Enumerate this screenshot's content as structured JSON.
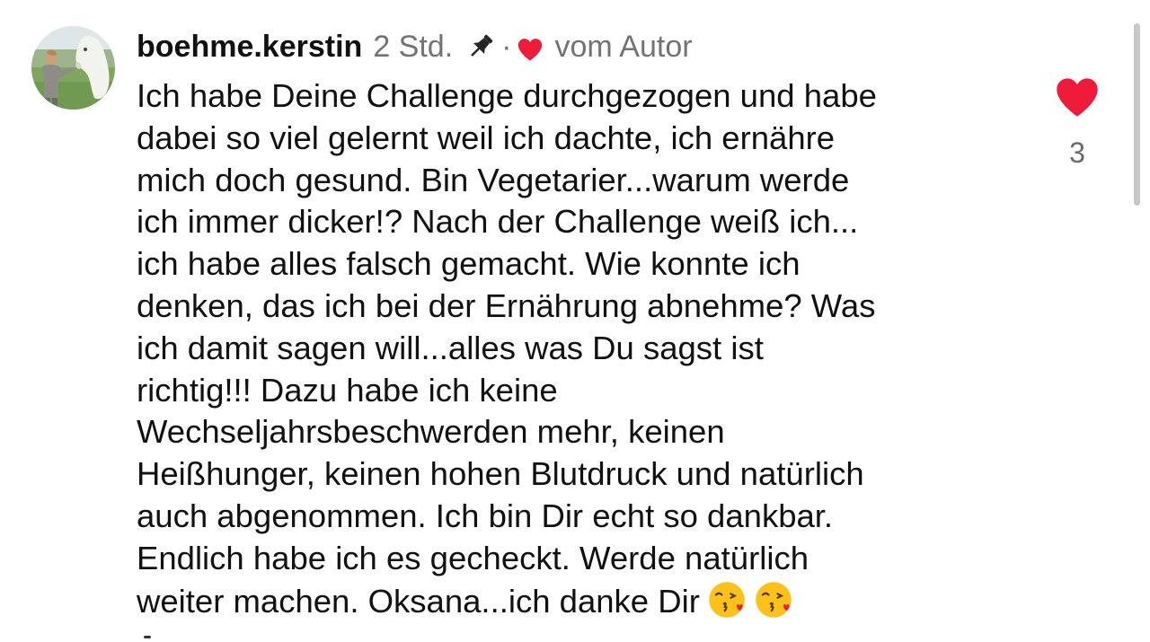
{
  "comment": {
    "username": "boehme.kerstin",
    "time": "2 Std.",
    "separator": "·",
    "author_label": "vom Autor",
    "lines": [
      "Ich habe Deine Challenge durchgezogen und habe",
      "dabei so viel gelernt weil ich dachte, ich ernähre",
      "mich doch gesund. Bin Vegetarier...warum werde",
      "ich immer dicker!? Nach der Challenge weiß ich...",
      "ich habe alles falsch gemacht. Wie konnte ich",
      "denken, das ich bei der Ernährung abnehme? Was",
      "ich damit sagen will...alles was Du sagst ist",
      "richtig!!! Dazu habe ich keine",
      "Wechseljahrsbeschwerden mehr, keinen",
      "Heißhunger, keinen hohen Blutdruck und natürlich",
      "auch abgenommen. Ich bin Dir echt so dankbar.",
      "Endlich habe ich es gecheckt. Werde natürlich",
      "weiter machen. Oksana...ich danke Dir"
    ],
    "emojis": [
      "face-blowing-kiss",
      "face-blowing-kiss"
    ],
    "like_count": "3",
    "colors": {
      "heart": "#ed1c3b",
      "muted_text": "#737373",
      "text": "#111111"
    }
  }
}
